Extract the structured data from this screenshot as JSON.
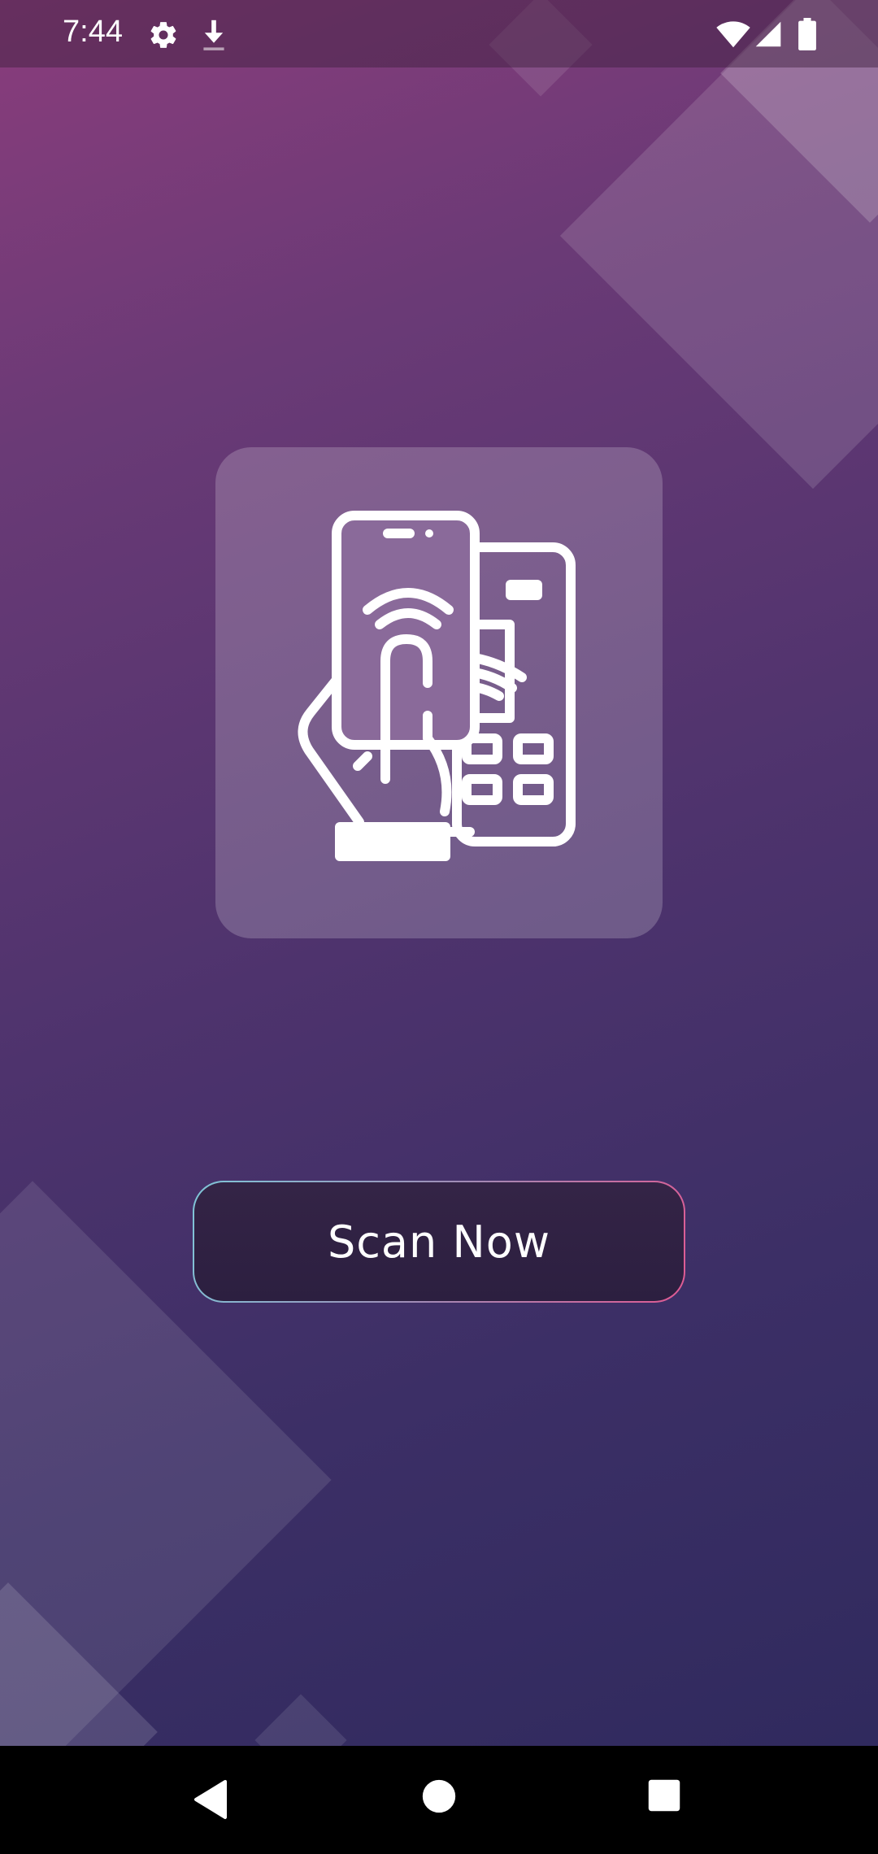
{
  "status_bar": {
    "time": "7:44",
    "icons": [
      "settings-icon",
      "download-icon",
      "wifi-icon",
      "signal-icon",
      "battery-icon"
    ]
  },
  "main": {
    "illustration": "nfc-phone-payment-icon",
    "scan_button_label": "Scan Now"
  },
  "navigation": {
    "buttons": [
      "back",
      "home",
      "recents"
    ]
  },
  "colors": {
    "accent_gradient_start": "#7fc6d8",
    "accent_gradient_end": "#e05a93",
    "background_top": "#8a3d7c",
    "background_bottom": "#302a5e"
  }
}
